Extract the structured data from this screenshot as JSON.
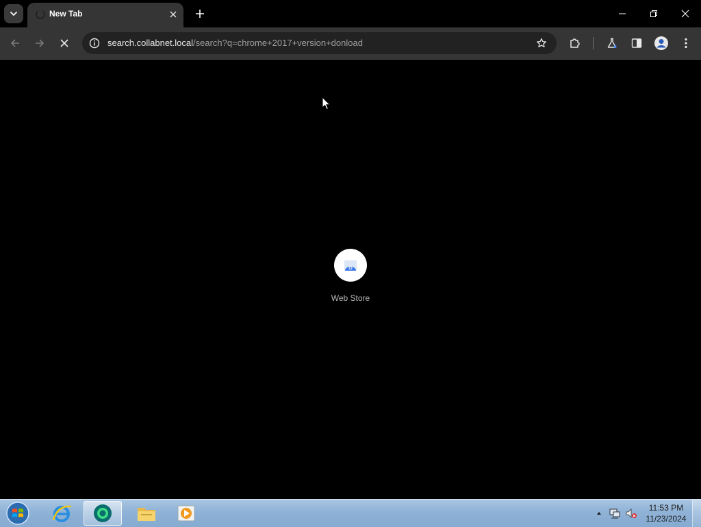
{
  "browser": {
    "tab": {
      "title": "New Tab",
      "loading": true
    },
    "toolbar": {
      "url_host": "search.collabnet.local",
      "url_path": "/search?q=chrome+2017+version+donload",
      "loading": true
    },
    "icons": {
      "tab_search": "chevron-down-icon",
      "tab_close": "close-icon",
      "new_tab": "plus-icon",
      "minimize": "minimize-icon",
      "restore": "restore-icon",
      "close_window": "close-icon",
      "back": "arrow-left-icon",
      "forward": "arrow-right-icon",
      "stop": "stop-icon",
      "site_info": "info-icon",
      "bookmark": "star-icon",
      "extensions": "puzzle-icon",
      "labs": "flask-icon",
      "side_panel": "side-panel-icon",
      "profile": "profile-icon",
      "menu": "kebab-menu-icon"
    }
  },
  "new_tab_page": {
    "shortcuts": [
      {
        "label": "Web Store",
        "icon": "web-store-icon"
      }
    ]
  },
  "taskbar": {
    "pinned": [
      {
        "name": "internet-explorer",
        "icon": "internet-explorer-icon",
        "active": false
      },
      {
        "name": "chrome-canary",
        "icon": "browser-icon",
        "active": true
      },
      {
        "name": "file-explorer",
        "icon": "folder-icon",
        "active": false
      },
      {
        "name": "media-player",
        "icon": "media-player-icon",
        "active": false
      }
    ],
    "clock": {
      "time": "11:53 PM",
      "date": "11/23/2024"
    },
    "tray_icons": [
      "show-hidden-icons-icon",
      "network-icon",
      "volume-muted-icon"
    ]
  },
  "colors": {
    "tab_active_bg": "#353535",
    "toolbar_bg": "#353535",
    "omnibox_bg": "#222222",
    "page_bg": "#000000",
    "taskbar_bg": "#8fb2d6"
  }
}
